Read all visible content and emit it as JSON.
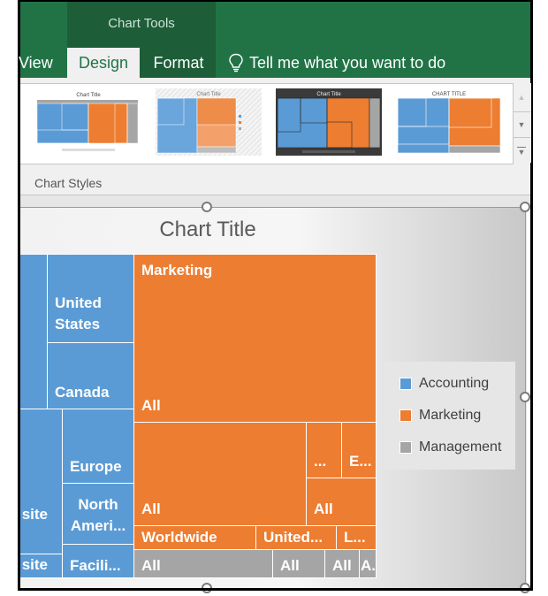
{
  "ribbon": {
    "context_group": "Chart Tools",
    "tabs": [
      {
        "label": "View",
        "active": false
      },
      {
        "label": "Design",
        "active": true
      },
      {
        "label": "Format",
        "active": false
      }
    ],
    "tell_me": {
      "icon": "lightbulb-icon",
      "text": "Tell me what you want to do"
    },
    "gallery": {
      "group_label": "Chart Styles",
      "styles": [
        {
          "name": "Style 1",
          "title": "Chart Title",
          "background": "#ffffff"
        },
        {
          "name": "Style 2",
          "title": "Chart Title",
          "background": "#eeeeee"
        },
        {
          "name": "Style 3",
          "title": "Chart Title",
          "background": "#3a3a3a"
        },
        {
          "name": "Style 4",
          "title": "CHART TITLE",
          "background": "#ffffff"
        }
      ],
      "scroll_up_icon": "triangle-up-icon",
      "scroll_down_icon": "triangle-down-icon",
      "more_icon": "gallery-expand-icon"
    }
  },
  "colors": {
    "ribbon_green": "#217346",
    "context_green": "#1d5d38",
    "accounting": "#5b9bd5",
    "marketing": "#ed7d31",
    "management": "#a5a5a5"
  },
  "chart_data": {
    "type": "treemap",
    "title": "Chart Title",
    "legend": {
      "position": "right",
      "entries": [
        {
          "label": "Accounting",
          "color": "#5b9bd5"
        },
        {
          "label": "Marketing",
          "color": "#ed7d31"
        },
        {
          "label": "Management",
          "color": "#a5a5a5"
        }
      ]
    },
    "visible_tiles": [
      {
        "category": "Accounting",
        "label": ""
      },
      {
        "category": "Accounting",
        "label": "United States"
      },
      {
        "category": "Accounting",
        "label": "Canada"
      },
      {
        "category": "Accounting",
        "label": "site"
      },
      {
        "category": "Accounting",
        "label": "site"
      },
      {
        "category": "Accounting",
        "label": "Europe"
      },
      {
        "category": "Accounting",
        "label": "North Ameri..."
      },
      {
        "category": "Accounting",
        "label": "Facili..."
      },
      {
        "category": "Marketing",
        "label": "Marketing",
        "sublabel": "All"
      },
      {
        "category": "Marketing",
        "label": "All"
      },
      {
        "category": "Marketing",
        "label": "..."
      },
      {
        "category": "Marketing",
        "label": "E..."
      },
      {
        "category": "Marketing",
        "label": "All"
      },
      {
        "category": "Marketing",
        "label": "Worldwide"
      },
      {
        "category": "Marketing",
        "label": "United..."
      },
      {
        "category": "Marketing",
        "label": "L..."
      },
      {
        "category": "Management",
        "label": "All"
      },
      {
        "category": "Management",
        "label": "All"
      },
      {
        "category": "Management",
        "label": "All"
      },
      {
        "category": "Management",
        "label": "A..."
      }
    ]
  }
}
